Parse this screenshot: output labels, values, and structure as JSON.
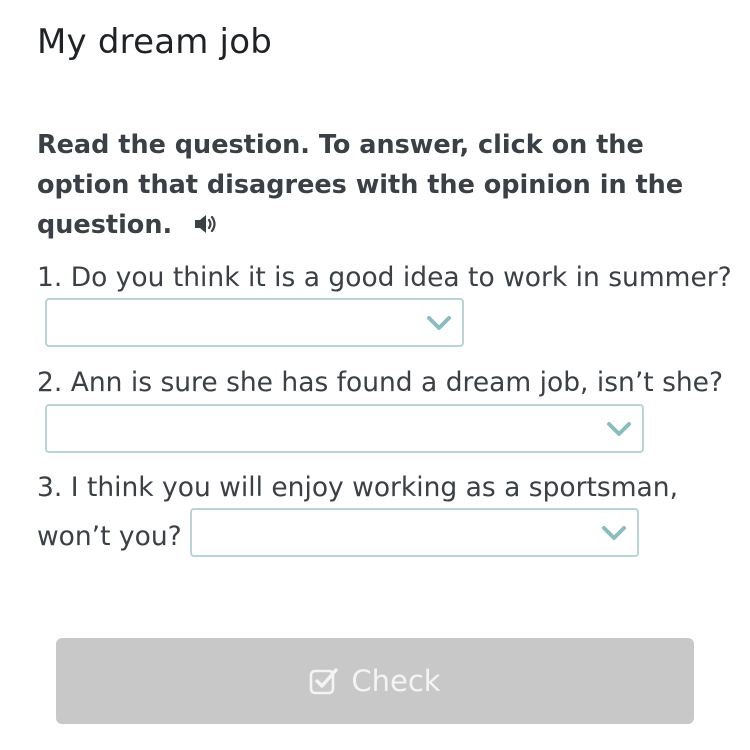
{
  "page": {
    "title": "My dream job"
  },
  "instructions": {
    "text": "Read the question. To answer, click on the option that disagrees with the opinion in the question.",
    "audio_icon": "speaker-icon"
  },
  "questions": [
    {
      "text": "1. Do you think it is a good idea to work in summer?",
      "selected": ""
    },
    {
      "text": "2. Ann is sure she has found a dream job, isn’t she?",
      "selected": ""
    },
    {
      "text_line1": "3. I think you will enjoy working as a sportsman,",
      "text_line2": "won’t you?",
      "selected": ""
    }
  ],
  "dropdown_icon": "chevron-down-icon",
  "check_button": {
    "label": "Check",
    "icon": "checkbox-check-icon",
    "state": "disabled"
  },
  "colors": {
    "dropdown_border": "#b9d4d6",
    "chevron": "#8bbcc0",
    "button_bg": "#c8c8c8",
    "button_text": "#f4f4f4",
    "text": "#3a4046"
  }
}
